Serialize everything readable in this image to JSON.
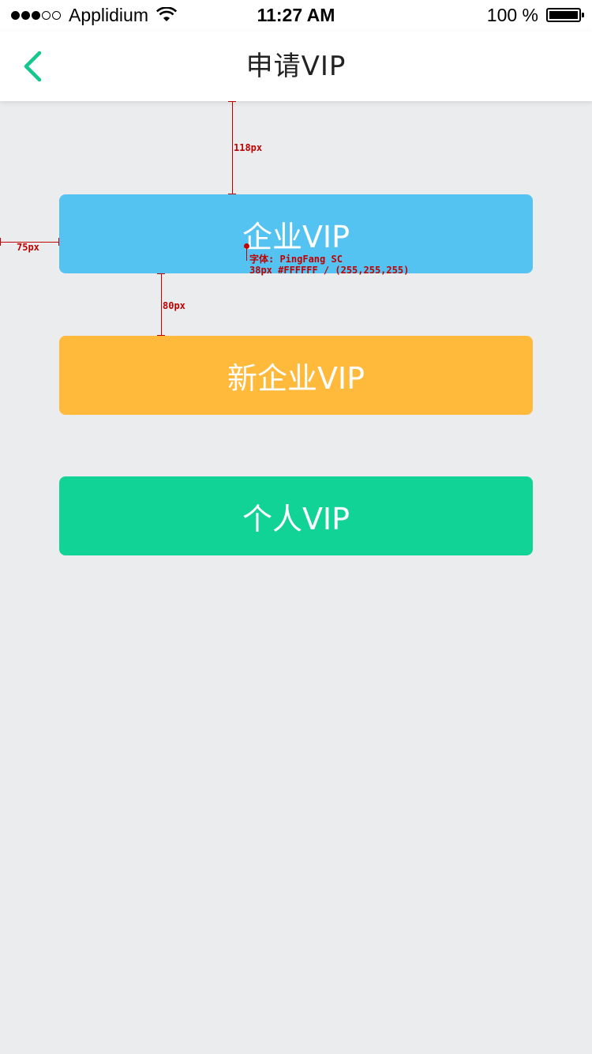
{
  "status_bar": {
    "signal_dots": 5,
    "signal_filled": 3,
    "carrier": "Applidium",
    "time": "11:27 AM",
    "battery": "100 %",
    "battery_level": 1.0
  },
  "nav": {
    "title": "申请VIP",
    "back_icon": "chevron-left-icon",
    "accent": "#13c88e"
  },
  "buttons": [
    {
      "label": "企业VIP",
      "color": "#55c3f2"
    },
    {
      "label": "新企业VIP",
      "color": "#ffb93b"
    },
    {
      "label": "个人VIP",
      "color": "#12d396"
    }
  ],
  "annotations": {
    "top_gap": "118px",
    "left_gap": "75px",
    "middle_gap": "80px",
    "font_line1": "字体: PingFang SC",
    "font_line2": "38px #FFFFFF / (255,255,255)"
  }
}
